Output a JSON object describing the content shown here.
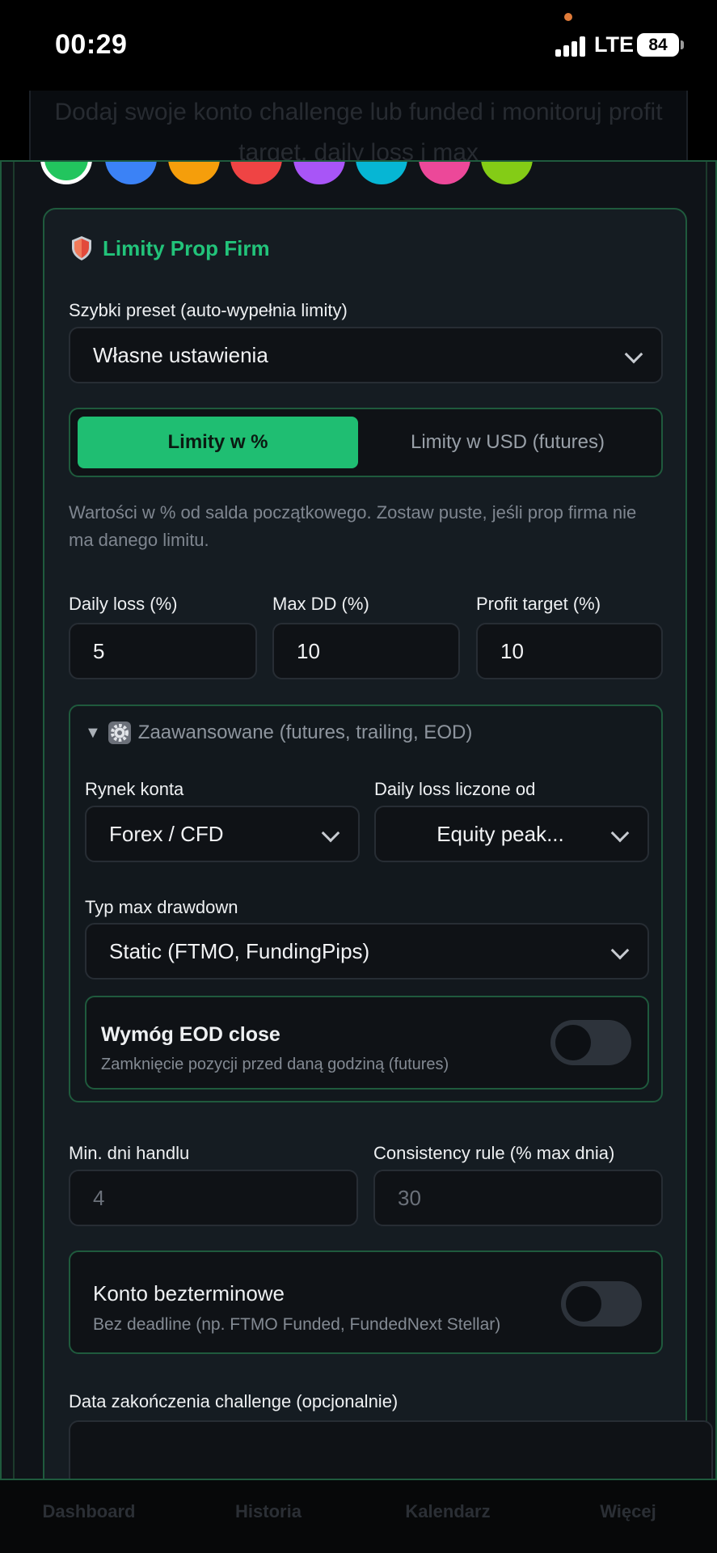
{
  "status_bar": {
    "time": "00:29",
    "network": "LTE",
    "battery": "84"
  },
  "background_header": {
    "text": "Dodaj swoje konto challenge lub funded i monitoruj profit target, daily loss i max"
  },
  "colors": {
    "swatches": [
      "#22c55e",
      "#3b82f6",
      "#f59e0b",
      "#ef4444",
      "#a855f7",
      "#06b6d4",
      "#ec4899",
      "#84cc16"
    ],
    "selected_index": 0
  },
  "prop_limits": {
    "title": "Limity Prop Firm",
    "preset": {
      "label": "Szybki preset (auto-wypełnia limity)",
      "value": "Własne ustawienia"
    },
    "mode": {
      "percent_label": "Limity w %",
      "usd_label": "Limity w USD (futures)",
      "selected": "percent"
    },
    "hint": "Wartości w % od salda początkowego. Zostaw puste, jeśli prop firma nie ma danego limitu.",
    "daily_loss": {
      "label": "Daily loss (%)",
      "value": "5"
    },
    "max_dd": {
      "label": "Max DD (%)",
      "value": "10"
    },
    "profit_target": {
      "label": "Profit target (%)",
      "value": "10"
    },
    "advanced": {
      "title": "Zaawansowane (futures, trailing, EOD)",
      "market": {
        "label": "Rynek konta",
        "value": "Forex / CFD"
      },
      "daily_loss_from": {
        "label": "Daily loss liczone od",
        "value": "Equity peak..."
      },
      "dd_type": {
        "label": "Typ max drawdown",
        "value": "Static (FTMO, FundingPips)"
      },
      "eod": {
        "title": "Wymóg EOD close",
        "subtitle": "Zamknięcie pozycji przed daną godziną (futures)",
        "enabled": false
      }
    },
    "min_days": {
      "label": "Min. dni handlu",
      "placeholder": "4"
    },
    "consistency": {
      "label": "Consistency rule (% max dnia)",
      "placeholder": "30"
    },
    "unlimited": {
      "title": "Konto bezterminowe",
      "subtitle": "Bez deadline (np. FTMO Funded, FundedNext Stellar)",
      "enabled": false
    },
    "end_date": {
      "label": "Data zakończenia challenge (opcjonalnie)"
    }
  },
  "tab_bar": {
    "items": [
      "Dashboard",
      "Historia",
      "Kalendarz",
      "Więcej"
    ]
  }
}
